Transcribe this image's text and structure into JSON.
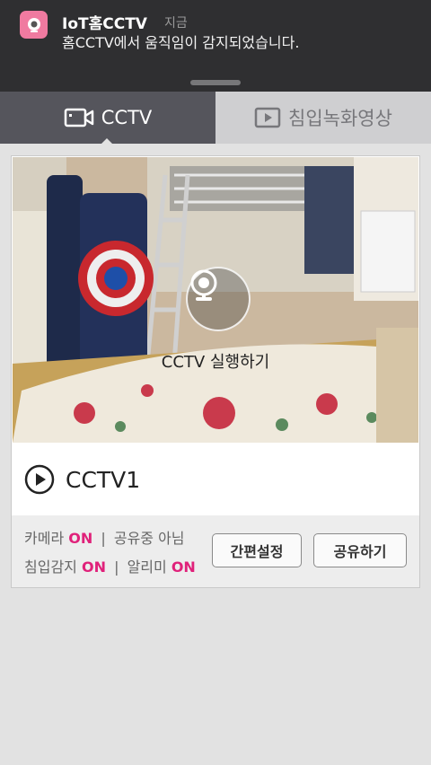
{
  "notification": {
    "app_name": "IoT홈CCTV",
    "time": "지금",
    "message": "홈CCTV에서 움직임이 감지되었습니다."
  },
  "tabs": [
    {
      "label": "CCTV",
      "icon": "camera-icon",
      "active": true
    },
    {
      "label": "침입녹화영상",
      "icon": "video-play-icon",
      "active": false
    }
  ],
  "camera_card": {
    "run_label": "CCTV 실행하기",
    "device_name": "CCTV1",
    "status": {
      "camera_label": "카메라",
      "camera_value": "ON",
      "sharing_text": "공유중 아님",
      "intrusion_label": "침입감지",
      "intrusion_value": "ON",
      "alarm_label": "알리미",
      "alarm_value": "ON"
    },
    "buttons": {
      "quick_settings": "간편설정",
      "share": "공유하기"
    }
  },
  "colors": {
    "accent": "#e0217a",
    "active_tab": "#55555c",
    "inactive_tab": "#cfcfd1",
    "notification_bg": "#2f2f31"
  }
}
